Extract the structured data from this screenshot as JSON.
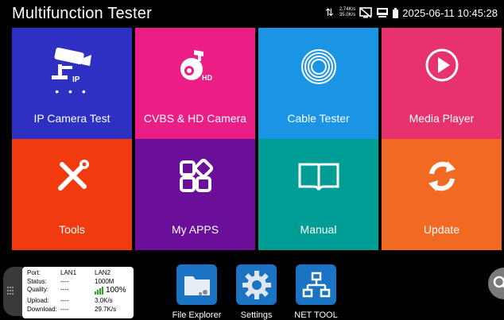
{
  "status_bar": {
    "title": "Multifunction Tester",
    "net_up": "2.74K/s",
    "net_down": "35.0K/s",
    "datetime": "2025-06-11 10:45:28"
  },
  "tiles": [
    {
      "label": "IP Camera Test",
      "color": "#2e30c4",
      "icon": "ip-camera-icon",
      "icon_text": "IP",
      "dots": "• • •"
    },
    {
      "label": "CVBS & HD Camera",
      "color": "#ea1e84",
      "icon": "hd-dome-camera-icon",
      "icon_text": "HD"
    },
    {
      "label": "Cable Tester",
      "color": "#1a95e6",
      "icon": "cable-coil-icon"
    },
    {
      "label": "Media Player",
      "color": "#e7326e",
      "icon": "play-icon"
    },
    {
      "label": "Tools",
      "color": "#f23a10",
      "icon": "tools-icon"
    },
    {
      "label": "My APPS",
      "color": "#6b0e9a",
      "icon": "apps-icon"
    },
    {
      "label": "Manual",
      "color": "#009d94",
      "icon": "book-icon"
    },
    {
      "label": "Update",
      "color": "#f26922",
      "icon": "refresh-icon"
    }
  ],
  "network_panel": {
    "headers": [
      "Port:",
      "LAN1",
      "LAN2"
    ],
    "rows": [
      [
        "Status:",
        "----",
        "1000M"
      ],
      [
        "Quality:",
        "----",
        "100%"
      ],
      [
        "Upload:",
        "----",
        "3.0K/s"
      ],
      [
        "Download:",
        "----",
        "29.7K/s"
      ]
    ],
    "quality_color": "#23a51c"
  },
  "dock": [
    {
      "label": "File Explorer",
      "icon": "folder-icon"
    },
    {
      "label": "Settings",
      "icon": "gear-icon"
    },
    {
      "label": "NET TOOL",
      "icon": "network-icon"
    }
  ]
}
